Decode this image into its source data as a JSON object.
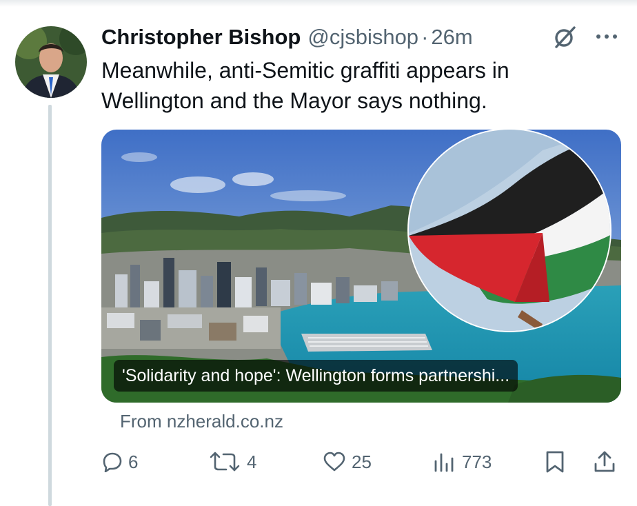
{
  "tweet": {
    "author_name": "Christopher Bishop",
    "handle": "@cjsbishop",
    "separator": "·",
    "time": "26m",
    "text": "Meanwhile, anti-Semitic graffiti appears in Wellington and the Mayor says nothing."
  },
  "card": {
    "headline": "'Solidarity and hope': Wellington forms partnershi...",
    "source": "From nzherald.co.nz"
  },
  "actions": {
    "replies": "6",
    "reposts": "4",
    "likes": "25",
    "views": "773"
  },
  "icons": {
    "reply": "reply-icon",
    "repost": "repost-icon",
    "like": "heart-icon",
    "views": "views-icon",
    "bookmark": "bookmark-icon",
    "share": "share-icon",
    "grok": "grok-icon",
    "more": "more-icon"
  },
  "colors": {
    "text_primary": "#0f1419",
    "text_secondary": "#536471",
    "thread_line": "#cfd9de"
  }
}
